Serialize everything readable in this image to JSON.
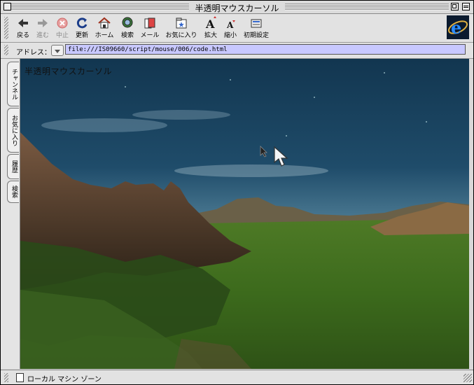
{
  "window": {
    "title": "半透明マウスカーソル"
  },
  "toolbar": {
    "buttons": [
      {
        "label": "戻る",
        "icon": "back-arrow-icon",
        "enabled": true
      },
      {
        "label": "進む",
        "icon": "forward-arrow-icon",
        "enabled": false
      },
      {
        "label": "中止",
        "icon": "stop-icon",
        "enabled": false
      },
      {
        "label": "更新",
        "icon": "refresh-icon",
        "enabled": true
      },
      {
        "label": "ホーム",
        "icon": "home-icon",
        "enabled": true
      },
      {
        "label": "検索",
        "icon": "search-icon",
        "enabled": true
      },
      {
        "label": "メール",
        "icon": "mail-icon",
        "enabled": true
      },
      {
        "label": "お気に入り",
        "icon": "favorites-icon",
        "enabled": true
      },
      {
        "label": "拡大",
        "icon": "text-larger-icon",
        "enabled": true
      },
      {
        "label": "縮小",
        "icon": "text-smaller-icon",
        "enabled": true
      },
      {
        "label": "初期設定",
        "icon": "preferences-icon",
        "enabled": true
      }
    ],
    "brand_icon": "internet-explorer-logo"
  },
  "address": {
    "label": "アドレス：",
    "url": "file:///IS09660/script/mouse/006/code.html"
  },
  "side_tabs": [
    "チャンネル",
    "お気に入り",
    "履歴",
    "検索"
  ],
  "page": {
    "heading": "半透明マウスカーソル"
  },
  "status": {
    "text": "ローカル マシン ゾーン"
  },
  "colors": {
    "sky": "#1f4a66",
    "grass": "#3e6a1e",
    "address_field": "#c8c8ff"
  }
}
